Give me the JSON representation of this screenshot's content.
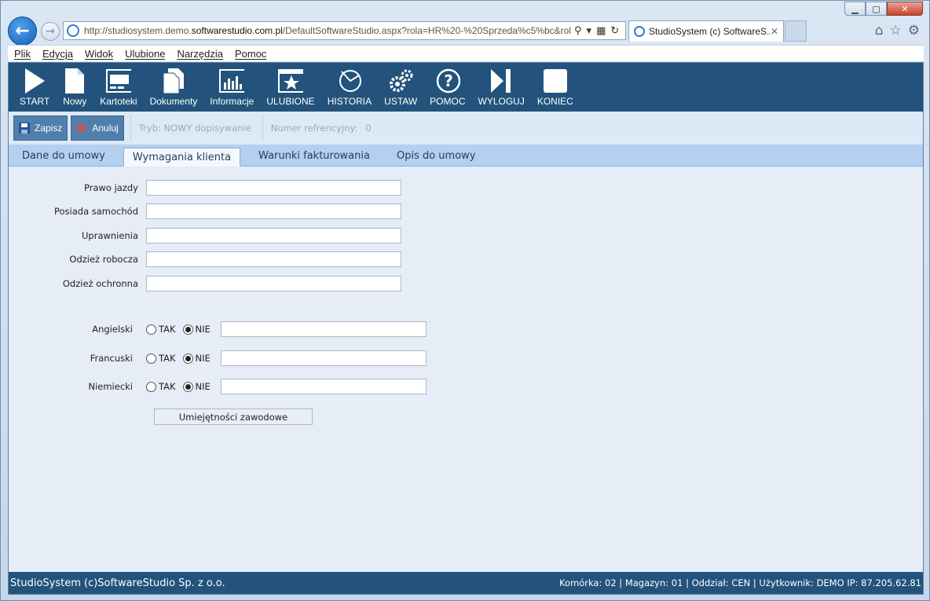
{
  "browser": {
    "url_prefix": "http://studiosystem.demo.",
    "url_host": "softwarestudio.com.pl",
    "url_rest": "/DefaultSoftwareStudio.aspx?rola=HR%20-%20Sprzeda%c5%bc&rol",
    "tab_title": "StudioSystem (c) SoftwareS...",
    "menu": [
      "Plik",
      "Edycja",
      "Widok",
      "Ulubione",
      "Narzędzia",
      "Pomoc"
    ]
  },
  "toolbar": {
    "items": [
      {
        "label": "START",
        "icon": "play-icon"
      },
      {
        "label": "Nowy",
        "icon": "new-document-icon"
      },
      {
        "label": "Kartoteki",
        "icon": "card-index-icon"
      },
      {
        "label": "Dokumenty",
        "icon": "documents-icon"
      },
      {
        "label": "Informacje",
        "icon": "bar-chart-icon"
      },
      {
        "label": "ULUBIONE",
        "icon": "star-icon"
      },
      {
        "label": "HISTORIA",
        "icon": "history-icon"
      },
      {
        "label": "USTAW",
        "icon": "gears-icon"
      },
      {
        "label": "POMOC",
        "icon": "help-icon"
      },
      {
        "label": "WYLOGUJ",
        "icon": "logout-icon"
      },
      {
        "label": "KONIEC",
        "icon": "stop-icon"
      }
    ]
  },
  "actions": {
    "save_label": "Zapisz",
    "cancel_label": "Anuluj",
    "mode": "Tryb: NOWY dopisywanie",
    "ref": "Numer refrencyjny:",
    "ref_value": "0"
  },
  "tabs": [
    "Dane do umowy",
    "Wymagania klienta",
    "Warunki fakturowania",
    "Opis do umowy"
  ],
  "active_tab": "Wymagania klienta",
  "form": {
    "fields": [
      {
        "label": "Prawo jazdy",
        "value": ""
      },
      {
        "label": "Posiada samochód",
        "value": ""
      },
      {
        "label": "Uprawnienia",
        "value": ""
      },
      {
        "label": "Odzież robocza",
        "value": ""
      },
      {
        "label": "Odzież ochronna",
        "value": ""
      }
    ],
    "yes_label": "TAK",
    "no_label": "NIE",
    "languages": [
      {
        "label": "Angielski",
        "selected": "NIE",
        "value": ""
      },
      {
        "label": "Francuski",
        "selected": "NIE",
        "value": ""
      },
      {
        "label": "Niemiecki",
        "selected": "NIE",
        "value": ""
      }
    ],
    "skills_button": "Umiejętności zawodowe"
  },
  "status": {
    "left": "StudioSystem (c)SoftwareStudio Sp. z o.o.",
    "right": "Komórka: 02 | Magazyn: 01 | Oddział: CEN | Użytkownik: DEMO IP: 87.205.62.81"
  }
}
